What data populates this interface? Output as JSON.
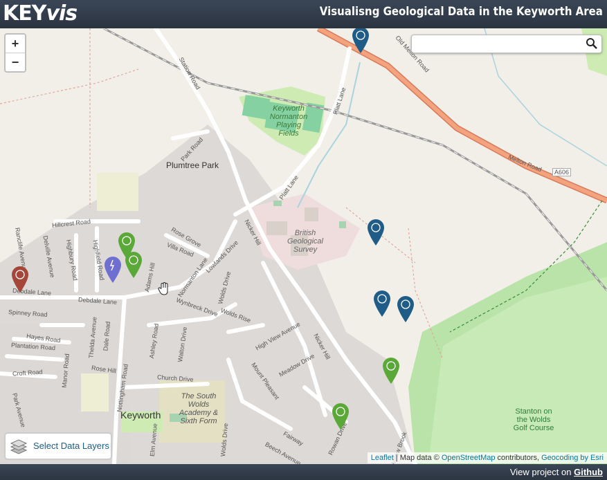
{
  "header": {
    "logo_main": "KEY",
    "logo_italic": "vis",
    "title": "Visualisng Geological Data in the Keyworth Area"
  },
  "footer": {
    "prefix": "View project on",
    "link": "Github"
  },
  "controls": {
    "zoom_in": "+",
    "zoom_out": "−",
    "search_placeholder": "",
    "layers_label": "Select Data Layers"
  },
  "attribution": {
    "leaflet": "Leaflet",
    "sep": " | Map data © ",
    "osm": "OpenStreetMap",
    "contrib": " contributors, ",
    "geocode": "Geocoding by Esri"
  },
  "map": {
    "roads": [
      "Station Road",
      "Old Melton Road",
      "Melton Road",
      "A606",
      "Platt Lane",
      "Platt Lane",
      "Park Road",
      "Nicker Hill",
      "Nicker Hill",
      "Hillcrest Road",
      "Rose Grove",
      "Villa Road",
      "Normanton Lane",
      "Lowlands Drive",
      "Wolds Drive",
      "Wolds Rise",
      "Wynbreck Drive",
      "Adams Hill",
      "Highfield Road",
      "Highbury Road",
      "Debdale Lane",
      "Debdale Lane",
      "Ranclife Avenue",
      "Delville Avenue",
      "Spinney Road",
      "Hayes Road",
      "Plantation Road",
      "Croft Road",
      "Park Avenue",
      "Nottingham Road",
      "Dale Road",
      "Thelda Avenue",
      "Rose Hill",
      "Ashley Road",
      "Walton Drive",
      "High View Avenue",
      "Meadow Drive",
      "Mount Pleasant",
      "Church Drive",
      "Elm Avenue",
      "Fairway",
      "Beech Avenue",
      "Rowan Drive",
      "Willow Brook",
      "Wolds Drive",
      "Manor Road"
    ],
    "places": [
      "Plumtree Park",
      "Keyworth Normanton Playing Fields",
      "British Geological Survey",
      "The South Wolds Academy & Sixth Form",
      "Keyworth",
      "Stanton on the Wolds Golf Course"
    ]
  },
  "markers": [
    {
      "type": "blue-borehole",
      "color": "#1f5c87"
    },
    {
      "type": "blue-borehole",
      "color": "#1f5c87"
    },
    {
      "type": "blue-borehole",
      "color": "#1f5c87"
    },
    {
      "type": "blue-borehole",
      "color": "#1f5c87"
    },
    {
      "type": "green-sample",
      "color": "#5aa837"
    },
    {
      "type": "green-sample",
      "color": "#5aa837"
    },
    {
      "type": "green-sample",
      "color": "#5aa837"
    },
    {
      "type": "green-sample",
      "color": "#5aa837"
    },
    {
      "type": "purple-fault",
      "color": "#6f6fd1"
    },
    {
      "type": "red-sample",
      "color": "#a4473a"
    }
  ]
}
